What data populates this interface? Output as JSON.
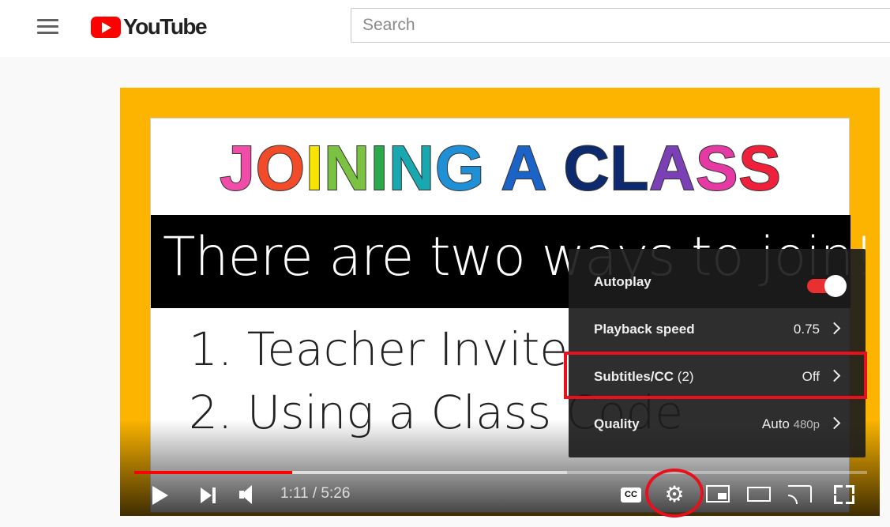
{
  "header": {
    "logo_text": "YouTube",
    "search_placeholder": "Search"
  },
  "video": {
    "slide_title_letters": [
      {
        "ch": "J",
        "color": "#f04da8"
      },
      {
        "ch": "O",
        "color": "#f24b2a"
      },
      {
        "ch": "I",
        "color": "#f7e400"
      },
      {
        "ch": "N",
        "color": "#7cc242"
      },
      {
        "ch": "I",
        "color": "#2aa84a"
      },
      {
        "ch": "N",
        "color": "#19a7b0"
      },
      {
        "ch": "G",
        "color": "#1f8fd6"
      },
      {
        "ch": " ",
        "color": "#000000"
      },
      {
        "ch": "A",
        "color": "#1b63c6"
      },
      {
        "ch": " ",
        "color": "#000000"
      },
      {
        "ch": "C",
        "color": "#0d2a6e"
      },
      {
        "ch": "L",
        "color": "#0d2a6e"
      },
      {
        "ch": "A",
        "color": "#7b3fb6"
      },
      {
        "ch": "S",
        "color": "#e53aa3"
      },
      {
        "ch": "S",
        "color": "#f0203a"
      }
    ],
    "band_text": "There are two ways to join!",
    "list": [
      "1.  Teacher Invite",
      "2. Using a Class Code"
    ]
  },
  "settings_menu": {
    "autoplay_label": "Autoplay",
    "autoplay_on": true,
    "playback_label": "Playback speed",
    "playback_value": "0.75",
    "subtitles_label": "Subtitles/CC",
    "subtitles_count": "(2)",
    "subtitles_value": "Off",
    "quality_label": "Quality",
    "quality_value": "Auto",
    "quality_res": "480p"
  },
  "controls": {
    "time": "1:11 / 5:26",
    "cc_label": "CC",
    "progress_played": 0.216,
    "progress_buffered": 0.59
  },
  "colors": {
    "accent": "#ff0000",
    "annotation": "#e8101d",
    "frame": "#fcb400"
  }
}
